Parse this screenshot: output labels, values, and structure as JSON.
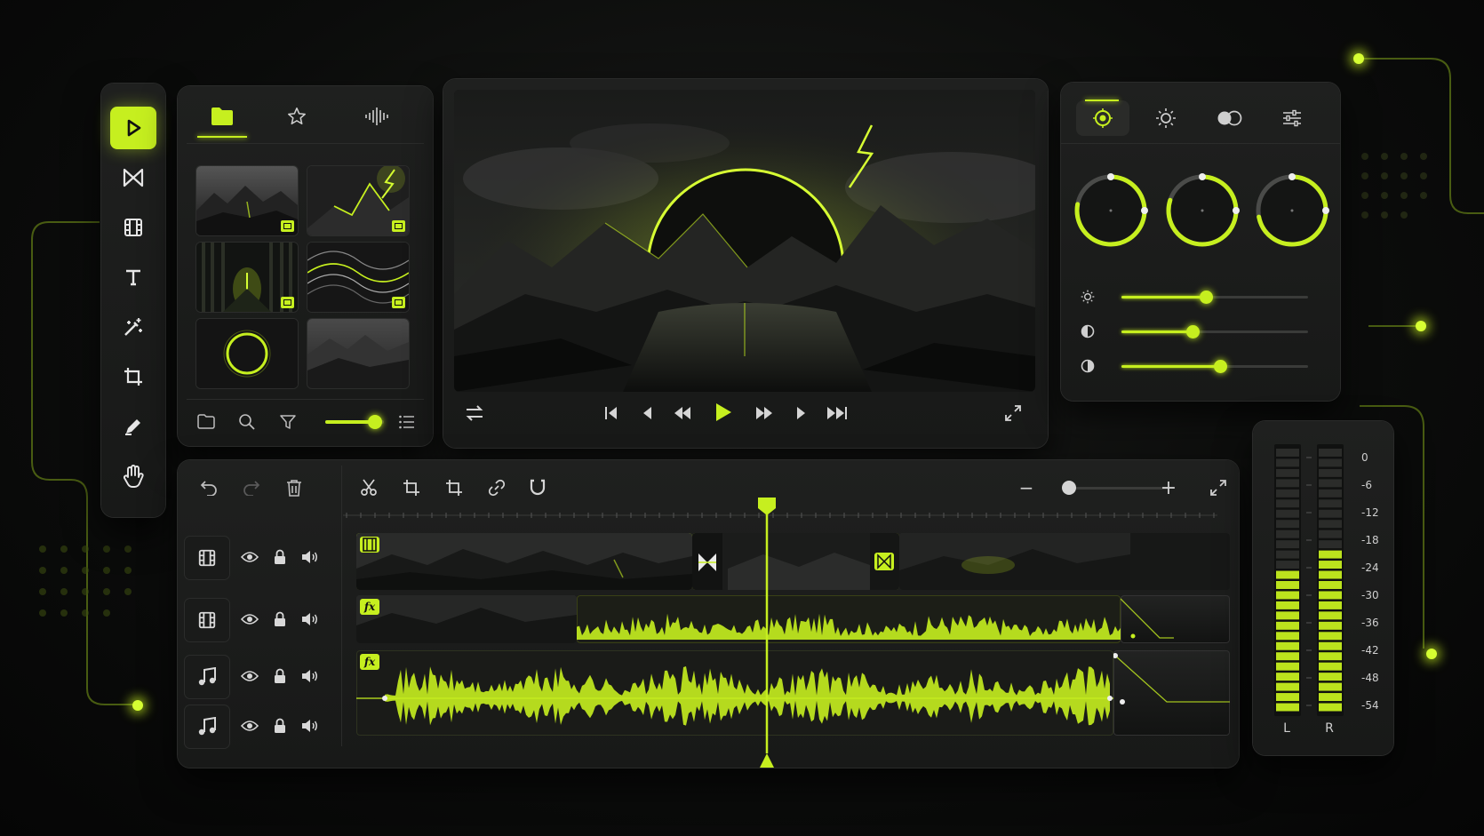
{
  "colors": {
    "accent": "#c6ef1f",
    "panel": "#1c1d1c",
    "background": "#0b0c0b"
  },
  "tool_rail": {
    "tools": [
      {
        "name": "play-tool",
        "icon": "play-icon",
        "active": true
      },
      {
        "name": "transition-tool",
        "icon": "bowtie-transition-icon"
      },
      {
        "name": "film-tool",
        "icon": "film-icon"
      },
      {
        "name": "text-tool",
        "icon": "text-icon"
      },
      {
        "name": "effects-tool",
        "icon": "magic-wand-icon"
      },
      {
        "name": "crop-tool",
        "icon": "crop-icon"
      },
      {
        "name": "pen-tool",
        "icon": "pen-icon"
      },
      {
        "name": "hand-tool",
        "icon": "hand-icon"
      }
    ]
  },
  "media_bin": {
    "tabs": [
      {
        "icon": "folder-icon",
        "active": true
      },
      {
        "icon": "star-icon"
      },
      {
        "icon": "audio-waveform-icon"
      }
    ],
    "thumbnails": [
      {
        "scene": "mountain lake",
        "badge": "video-badge-icon"
      },
      {
        "scene": "lightning peak",
        "badge": "video-badge-icon"
      },
      {
        "scene": "forest path",
        "badge": "film-badge-icon"
      },
      {
        "scene": "wave lines",
        "badge": "film-badge-icon"
      },
      {
        "scene": "glow ring"
      },
      {
        "scene": "misty mountains"
      }
    ],
    "footer": {
      "icons": [
        "folder-icon",
        "search-icon",
        "filter-icon",
        "list-icon"
      ],
      "zoom_fraction": 0.85
    }
  },
  "preview": {
    "controls": [
      "loop-icon",
      "skip-start-icon",
      "step-back-icon",
      "rewind-icon",
      "play-icon",
      "fast-forward-icon",
      "step-forward-icon",
      "skip-end-icon",
      "fullscreen-icon"
    ]
  },
  "color_panel": {
    "tabs": [
      "color-wheel-icon",
      "brightness-icon",
      "blend-icon",
      "sliders-icon"
    ],
    "wheels": [
      {
        "level": 0.78
      },
      {
        "level": 0.8
      },
      {
        "level": 0.72
      }
    ],
    "sliders": [
      {
        "icon": "brightness-icon",
        "value": 0.45
      },
      {
        "icon": "contrast-icon",
        "value": 0.38
      },
      {
        "icon": "saturation-icon",
        "value": 0.53
      }
    ]
  },
  "timeline": {
    "toolbar_left": [
      "undo-icon",
      "redo-icon",
      "trash-icon"
    ],
    "toolbar_mid": [
      "cut-icon",
      "trim-icon",
      "crop-icon",
      "link-icon",
      "magnet-icon"
    ],
    "zoom": {
      "minus": "−",
      "plus": "+",
      "fraction": 0.38
    },
    "playhead_fraction": 0.47,
    "tracks": [
      {
        "type": "film-icon",
        "kind": "video"
      },
      {
        "type": "film-icon",
        "kind": "video"
      },
      {
        "type": "music-icon",
        "kind": "audio"
      },
      {
        "type": "music-icon",
        "kind": "audio"
      }
    ],
    "fx_label": "fx"
  },
  "meter": {
    "labels": [
      "0",
      "-6",
      "-12",
      "-18",
      "-24",
      "-30",
      "-36",
      "-42",
      "-48",
      "-54"
    ],
    "channels": [
      "L",
      "R"
    ],
    "left_level": 0.55,
    "right_level": 0.63
  }
}
